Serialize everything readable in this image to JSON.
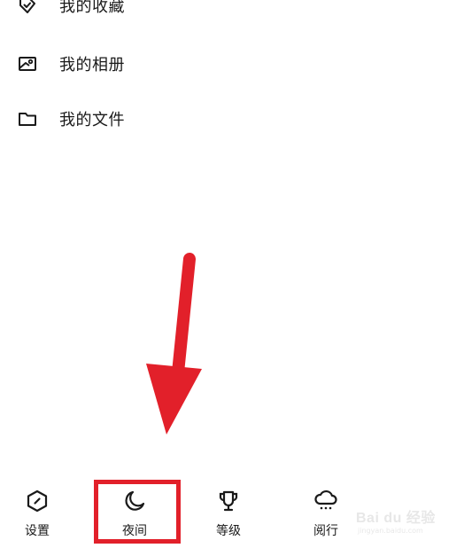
{
  "menu": {
    "items": [
      {
        "label": "我的收藏",
        "icon": "favorite-tag-icon"
      },
      {
        "label": "我的相册",
        "icon": "photo-album-icon"
      },
      {
        "label": "我的文件",
        "icon": "folder-icon"
      }
    ]
  },
  "bottom_nav": {
    "items": [
      {
        "label": "设置",
        "icon": "settings-hexagon-icon"
      },
      {
        "label": "夜间",
        "icon": "moon-icon"
      },
      {
        "label": "等级",
        "icon": "trophy-icon"
      },
      {
        "label": "阅行",
        "icon": "cloud-icon"
      }
    ]
  },
  "annotation": {
    "arrow_color": "#e2202a",
    "highlight_color": "#e2202a"
  },
  "watermark": {
    "brand": "Bai du 经验",
    "url": "jingyan.baidu.com"
  }
}
